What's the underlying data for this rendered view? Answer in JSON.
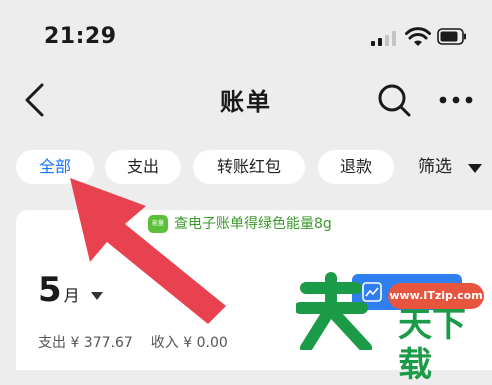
{
  "status_bar": {
    "time": "21:29",
    "icons": [
      "signal-icon",
      "wifi-icon",
      "battery-icon"
    ]
  },
  "nav": {
    "title": "账单",
    "icons": [
      "back-chevron-icon",
      "search-icon",
      "more-icon"
    ]
  },
  "tabs": [
    {
      "label": "全部",
      "active": true
    },
    {
      "label": "支出",
      "active": false
    },
    {
      "label": "转账红包",
      "active": false
    },
    {
      "label": "退款",
      "active": false
    }
  ],
  "filter": {
    "label": "筛选"
  },
  "promo": {
    "badge": "能量",
    "text": "查电子账单得绿色能量8g"
  },
  "summary": {
    "month_number": "5",
    "month_unit": "月",
    "expense": "支出 ¥ 377.67",
    "income": "收入 ¥ 0.00"
  },
  "watermark": {
    "site": "www.ITzip.com",
    "text": "天下载"
  },
  "colors": {
    "accent": "#1677ff",
    "green": "#3a9a2a",
    "arrow": "#e8414f",
    "background": "#ededed"
  }
}
